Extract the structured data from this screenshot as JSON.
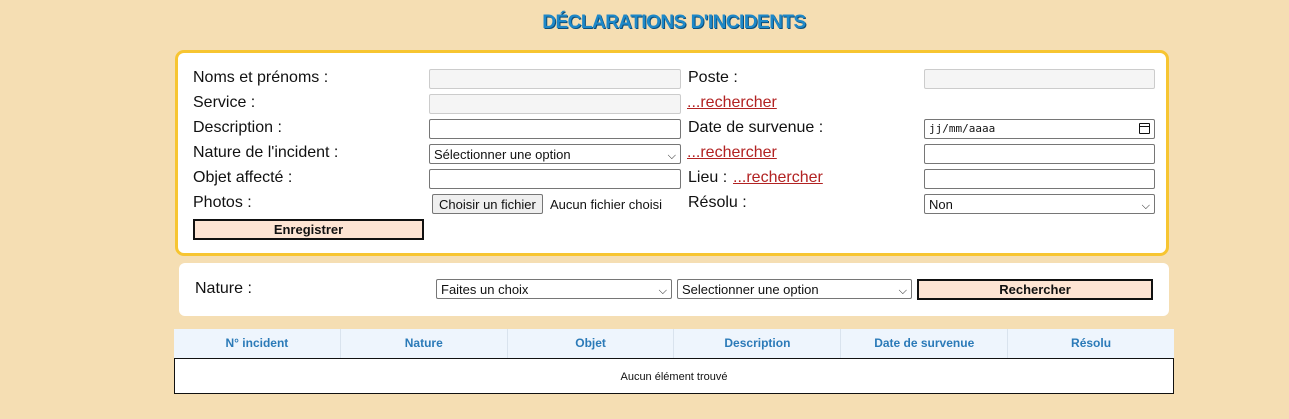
{
  "page_title": "DÉCLARATIONS D'INCIDENTS",
  "form": {
    "noms_label": "Noms et prénoms :",
    "poste_label": "Poste :",
    "service_label": "Service :",
    "service_link": "...rechercher",
    "description_label": "Description :",
    "date_label": "Date de survenue :",
    "date_placeholder": "jj/mm/aaaa",
    "nature_label": "Nature de l'incident :",
    "nature_select": "Sélectionner une option",
    "nature_link": "...rechercher",
    "objet_label": "Objet affecté :",
    "lieu_label": "Lieu :",
    "lieu_link": "...rechercher",
    "photos_label": "Photos :",
    "file_button": "Choisir un fichier",
    "file_status": "Aucun fichier choisi",
    "resolu_label": "Résolu :",
    "resolu_select": "Non",
    "save_button": "Enregistrer"
  },
  "search": {
    "nature_label": "Nature :",
    "choice_select": "Faites un choix",
    "option_select": "Selectionner une option",
    "search_button": "Rechercher"
  },
  "table": {
    "columns": [
      "N° incident",
      "Nature",
      "Objet",
      "Description",
      "Date de survenue",
      "Résolu"
    ],
    "empty_message": "Aucun élément trouvé"
  }
}
